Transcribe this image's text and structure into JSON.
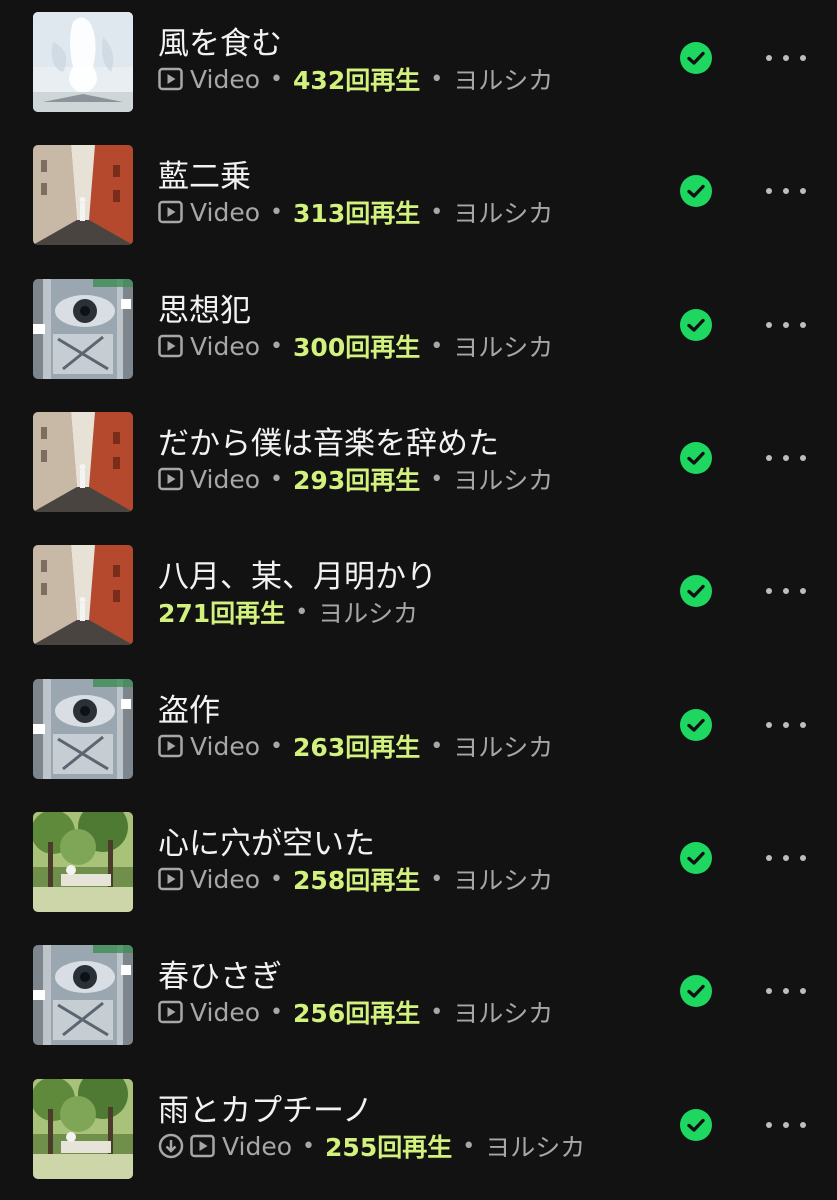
{
  "colors": {
    "background": "#121212",
    "title": "#f2f2f2",
    "meta": "#a7a7a7",
    "plays_accent": "#d2f17d",
    "downloaded_check": "#1ed760"
  },
  "tracks": [
    {
      "title": "風を食む",
      "type": "Video",
      "plays": "432回再生",
      "artist": "ヨルシカ",
      "art": "sky-art",
      "downloaded": true,
      "saved": true
    },
    {
      "title": "藍二乗",
      "type": "Video",
      "plays": "313回再生",
      "artist": "ヨルシカ",
      "art": "alley-art",
      "downloaded": true,
      "saved": true
    },
    {
      "title": "思想犯",
      "type": "Video",
      "plays": "300回再生",
      "artist": "ヨルシカ",
      "art": "collage-art",
      "downloaded": true,
      "saved": true
    },
    {
      "title": "だから僕は音楽を辞めた",
      "type": "Video",
      "plays": "293回再生",
      "artist": "ヨルシカ",
      "art": "alley-art",
      "downloaded": true,
      "saved": true
    },
    {
      "title": "八月、某、月明かり",
      "type": "",
      "plays": "271回再生",
      "artist": "ヨルシカ",
      "art": "alley-art",
      "downloaded": true,
      "saved": true
    },
    {
      "title": "盗作",
      "type": "Video",
      "plays": "263回再生",
      "artist": "ヨルシカ",
      "art": "collage-art",
      "downloaded": true,
      "saved": true
    },
    {
      "title": "心に穴が空いた",
      "type": "Video",
      "plays": "258回再生",
      "artist": "ヨルシカ",
      "art": "forest-art",
      "downloaded": true,
      "saved": true
    },
    {
      "title": "春ひさぎ",
      "type": "Video",
      "plays": "256回再生",
      "artist": "ヨルシカ",
      "art": "collage-art",
      "downloaded": true,
      "saved": true
    },
    {
      "title": "雨とカプチーノ",
      "type": "Video",
      "plays": "255回再生",
      "artist": "ヨルシカ",
      "art": "forest-art",
      "downloaded": false,
      "saved": true
    }
  ]
}
